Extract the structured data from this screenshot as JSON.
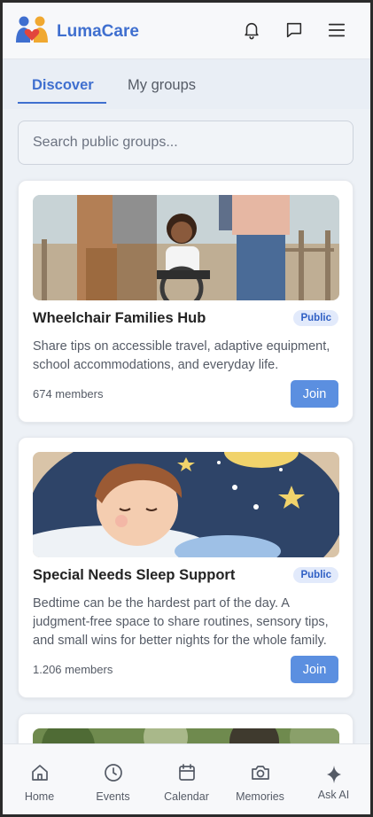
{
  "app": {
    "name": "LumaCare"
  },
  "header": {
    "icons": [
      "bell-icon",
      "message-icon",
      "menu-icon"
    ]
  },
  "tabs": [
    {
      "label": "Discover",
      "active": true
    },
    {
      "label": "My groups",
      "active": false
    }
  ],
  "search": {
    "placeholder": "Search public groups..."
  },
  "groups": [
    {
      "title": "Wheelchair Families Hub",
      "badge": "Public",
      "description": "Share tips on accessible travel, adaptive equipment, school accommodations, and everyday life.",
      "members": "674 members",
      "join_label": "Join"
    },
    {
      "title": "Special Needs Sleep Support",
      "badge": "Public",
      "description": "Bedtime can be the hardest part of the day. A judgment-free space to share routines, sensory tips, and small wins for better nights for the whole family.",
      "members": "1.206 members",
      "join_label": "Join"
    }
  ],
  "nav": [
    {
      "label": "Home",
      "icon": "home-icon"
    },
    {
      "label": "Events",
      "icon": "clock-icon"
    },
    {
      "label": "Calendar",
      "icon": "calendar-icon"
    },
    {
      "label": "Memories",
      "icon": "camera-icon"
    },
    {
      "label": "Ask AI",
      "icon": "sparkle-icon"
    }
  ],
  "colors": {
    "accent": "#3f6fcf",
    "join_button": "#5b8fe0",
    "badge_bg": "#e2eafb"
  }
}
